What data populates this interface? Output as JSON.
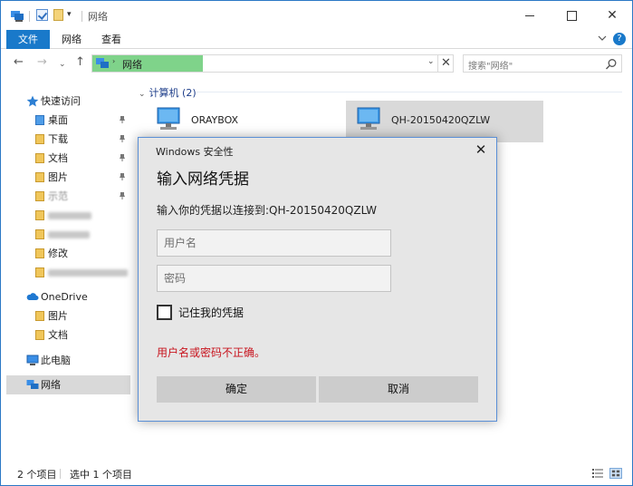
{
  "window": {
    "title": "网络",
    "ribbon_tabs": [
      "文件",
      "网络",
      "查看"
    ]
  },
  "address": {
    "path": "网络",
    "search_placeholder": "搜索\"网络\""
  },
  "sidebar": {
    "quick_access": "快速访问",
    "quick_items": [
      "桌面",
      "下载",
      "文档",
      "图片",
      "示范",
      "",
      "",
      "修改",
      ""
    ],
    "onedrive": "OneDrive",
    "onedrive_items": [
      "图片",
      "文档"
    ],
    "this_pc": "此电脑",
    "network": "网络"
  },
  "content": {
    "group_label": "计算机 (2)",
    "computers": [
      "ORAYBOX",
      "QH-20150420QZLW"
    ]
  },
  "status": {
    "item_count": "2 个项目",
    "selection": "选中 1 个项目"
  },
  "dialog": {
    "caption": "Windows 安全性",
    "title": "输入网络凭据",
    "description": "输入你的凭据以连接到:QH-20150420QZLW",
    "username_placeholder": "用户名",
    "password_placeholder": "密码",
    "remember_label": "记住我的凭据",
    "error_message": "用户名或密码不正确。",
    "ok_label": "确定",
    "cancel_label": "取消"
  },
  "colors": {
    "accent": "#1979ca",
    "address_fill": "#7fd38a",
    "error": "#c8141e",
    "dialog_bg": "#e6e6e6"
  }
}
